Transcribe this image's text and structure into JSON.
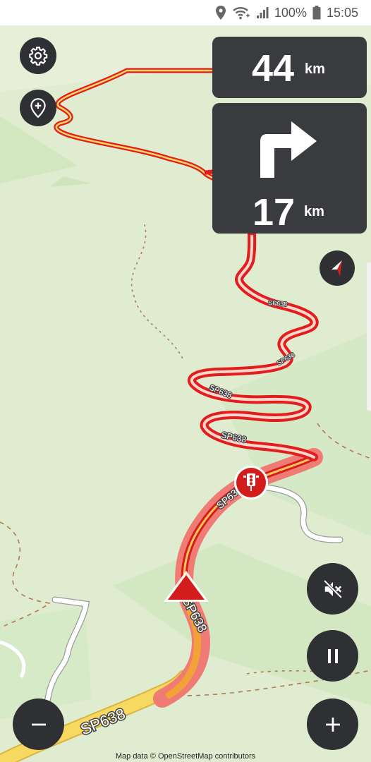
{
  "status_bar": {
    "battery_percent": "100%",
    "time": "15:05",
    "icons": [
      "location-icon",
      "wifi-calling-icon",
      "signal-icon",
      "battery-icon"
    ]
  },
  "navigation": {
    "remaining_distance": "44",
    "remaining_distance_unit": "km",
    "next_turn_direction": "right",
    "next_turn_distance": "17",
    "next_turn_distance_unit": "km"
  },
  "map": {
    "road_label": "SP638",
    "attribution": "Map data © OpenStreetMap contributors",
    "colors": {
      "background": "#dfeccf",
      "route_red": "#e11d1d",
      "route_halo": "#f07a74",
      "road_yellow": "#f7d861",
      "position_marker": "#d31c1c"
    }
  },
  "controls": {
    "settings": "gear-icon",
    "add_place": "location-plus-icon",
    "compass": "compass-icon",
    "mute": "volume-mute-icon",
    "pause": "pause-icon",
    "zoom_in": "plus-icon",
    "zoom_out": "minus-icon",
    "traffic_light": "traffic-light-icon"
  }
}
